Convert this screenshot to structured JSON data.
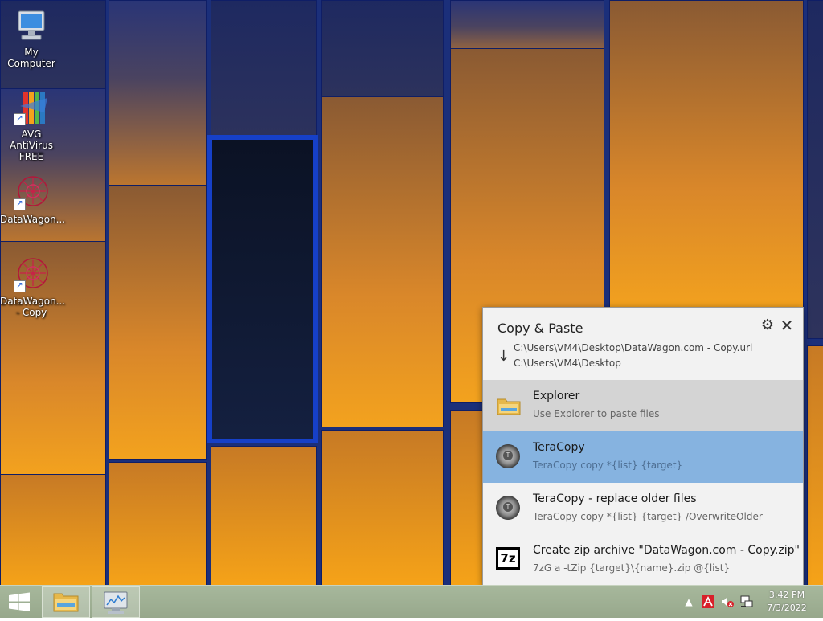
{
  "desktop": {
    "icons": [
      {
        "label": "My Computer",
        "icon": "computer-icon"
      },
      {
        "label": "AVG AntiVirus FREE",
        "icon": "avg-icon"
      },
      {
        "label": "DataWagon...",
        "icon": "datawagon-icon"
      },
      {
        "label": "DataWagon... - Copy",
        "icon": "datawagon-icon"
      }
    ]
  },
  "popup": {
    "title": "Copy & Paste",
    "source_path": "C:\\Users\\VM4\\Desktop\\DataWagon.com - Copy.url",
    "target_path": "C:\\Users\\VM4\\Desktop",
    "options": [
      {
        "title": "Explorer",
        "subtitle": "Use Explorer to paste files",
        "icon": "folder-icon"
      },
      {
        "title": "TeraCopy",
        "subtitle": "TeraCopy copy *{list} {target}",
        "icon": "teracopy-icon",
        "selected": true
      },
      {
        "title": "TeraCopy - replace older files",
        "subtitle": "TeraCopy copy *{list} {target} /OverwriteOlder",
        "icon": "teracopy-icon"
      },
      {
        "title": "Create zip archive \"DataWagon.com - Copy.zip\"",
        "subtitle": "7zG  a -tZip {target}\\{name}.zip @{list}",
        "icon": "7zip-icon"
      }
    ]
  },
  "taskbar": {
    "clock_time": "3:42 PM",
    "clock_date": "7/3/2022",
    "pinned": [
      {
        "name": "file-explorer",
        "icon": "folder-icon"
      },
      {
        "name": "resource-monitor",
        "icon": "monitor-icon"
      }
    ],
    "tray": [
      "show-hidden-icons",
      "avira-icon",
      "volume-muted-icon",
      "network-icon"
    ]
  },
  "colors": {
    "selected_option": "#86b3e0",
    "hover_option": "#d4d4d4",
    "taskbar": "#a0b195"
  }
}
